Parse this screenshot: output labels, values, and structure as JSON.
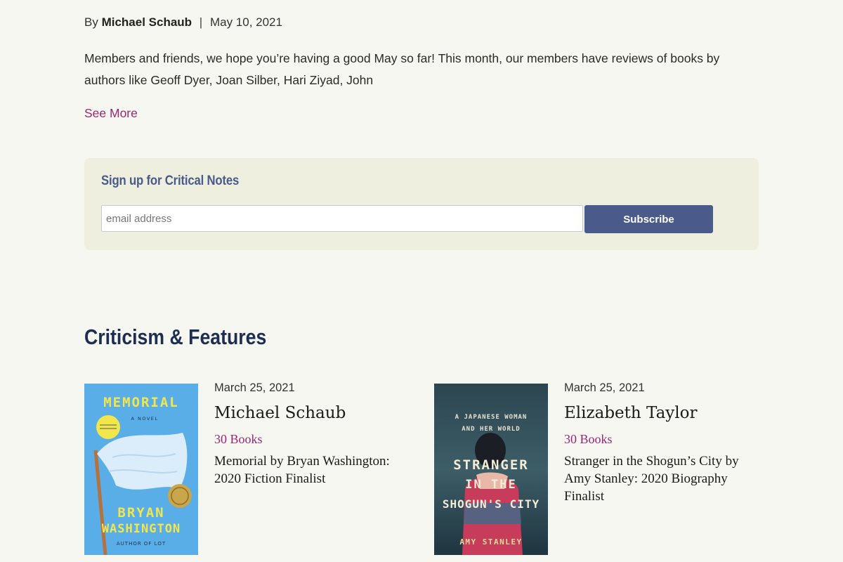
{
  "byline": {
    "prefix": "By",
    "author": "Michael Schaub",
    "separator": "|",
    "date": "May 10, 2021"
  },
  "excerpt": "Members and friends, we hope you’re having a good May so far! This month, our members have reviews of books by authors like Geoff Dyer, Joan Silber, Hari Ziyad, John",
  "see_more": "See More",
  "signup": {
    "title": "Sign up for Critical Notes",
    "email_placeholder": "email address",
    "email_value": "",
    "button": "Subscribe"
  },
  "section_title": "Criticism & Features",
  "colors": {
    "accent_magenta": "#9b2670",
    "navy": "#1d2e52",
    "button_blue": "#4a5a8a",
    "page_bg": "#f7f7f1",
    "signup_bg": "#eeefde"
  },
  "cards": [
    {
      "date": "March 25, 2021",
      "name": "Michael Schaub",
      "tag": "30 Books",
      "description": "Memorial by Bryan Washington: 2020 Fiction Finalist",
      "cover": {
        "title": "MEMORIAL",
        "subtitle": "A NOVEL",
        "author_line1": "BRYAN",
        "author_line2": "WASHINGTON",
        "footer": "AUTHOR OF LOT"
      }
    },
    {
      "date": "March 25, 2021",
      "name": "Elizabeth Taylor",
      "tag": "30 Books",
      "description": "Stranger in the Shogun’s City by Amy Stanley: 2020 Biography Finalist",
      "cover": {
        "tagline1": "A JAPANESE WOMAN",
        "tagline2": "AND HER WORLD",
        "title1": "STRANGER",
        "title2": "IN THE",
        "title3": "SHOGUN'S CITY",
        "author": "AMY STANLEY"
      }
    }
  ]
}
